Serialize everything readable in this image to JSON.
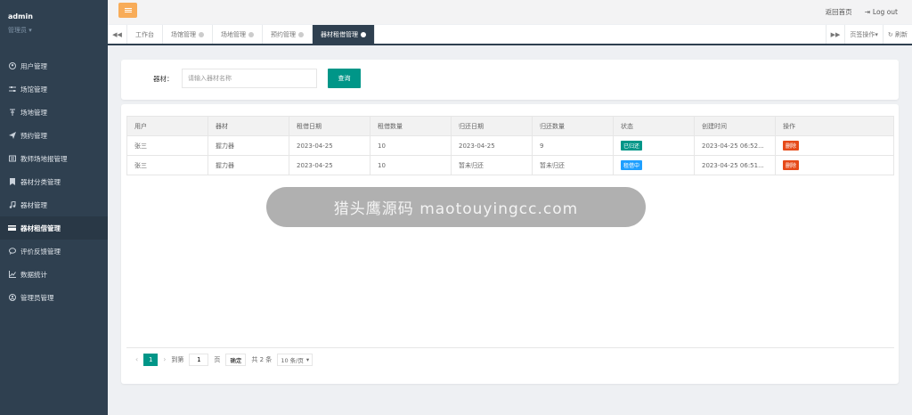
{
  "profile": {
    "username": "admin",
    "role": "管理员 ▾"
  },
  "sidebar": {
    "items": [
      {
        "label": "用户管理",
        "icon": "user-icon"
      },
      {
        "label": "场馆管理",
        "icon": "sliders-icon"
      },
      {
        "label": "场地管理",
        "icon": "pin-icon"
      },
      {
        "label": "预约管理",
        "icon": "send-icon"
      },
      {
        "label": "教师场地报管理",
        "icon": "list-icon"
      },
      {
        "label": "器材分类管理",
        "icon": "bookmark-icon"
      },
      {
        "label": "器材管理",
        "icon": "music-icon"
      },
      {
        "label": "器材租借管理",
        "icon": "card-icon"
      },
      {
        "label": "评价反馈管理",
        "icon": "comment-icon"
      },
      {
        "label": "数据统计",
        "icon": "chart-icon"
      },
      {
        "label": "管理员管理",
        "icon": "admin-icon"
      }
    ]
  },
  "topbar": {
    "home_link": "返回首页",
    "logout": "Log out"
  },
  "tabs": {
    "items": [
      {
        "label": "工作台"
      },
      {
        "label": "场馆管理"
      },
      {
        "label": "场地管理"
      },
      {
        "label": "预约管理"
      },
      {
        "label": "器材租借管理"
      }
    ],
    "page_ops": "页签操作▾",
    "refresh": "刷新"
  },
  "search": {
    "label": "器材：",
    "placeholder": "请输入器材名称",
    "button": "查询"
  },
  "table": {
    "headers": [
      "用户",
      "器材",
      "租借日期",
      "租借数量",
      "归还日期",
      "归还数量",
      "状态",
      "创建时间",
      "操作"
    ],
    "rows": [
      {
        "user": "张三",
        "equipment": "握力器",
        "rent_date": "2023-04-25",
        "rent_qty": "10",
        "return_date": "2023-04-25",
        "return_qty": "9",
        "status": "已归还",
        "status_color": "#009688",
        "created": "2023-04-25 06:52...",
        "action": "删除"
      },
      {
        "user": "张三",
        "equipment": "握力器",
        "rent_date": "2023-04-25",
        "rent_qty": "10",
        "return_date": "暂未归还",
        "return_qty": "暂未归还",
        "status": "租借中",
        "status_color": "#1e9fff",
        "created": "2023-04-25 06:51...",
        "action": "删除"
      }
    ]
  },
  "pager": {
    "current": "1",
    "goto_label": "到第",
    "goto_value": "1",
    "page_unit": "页",
    "confirm": "确定",
    "total": "共 2 条",
    "size": "10 条/页"
  },
  "overlay": {
    "text": "猎头鹰源码 maotouyingcc.com"
  }
}
